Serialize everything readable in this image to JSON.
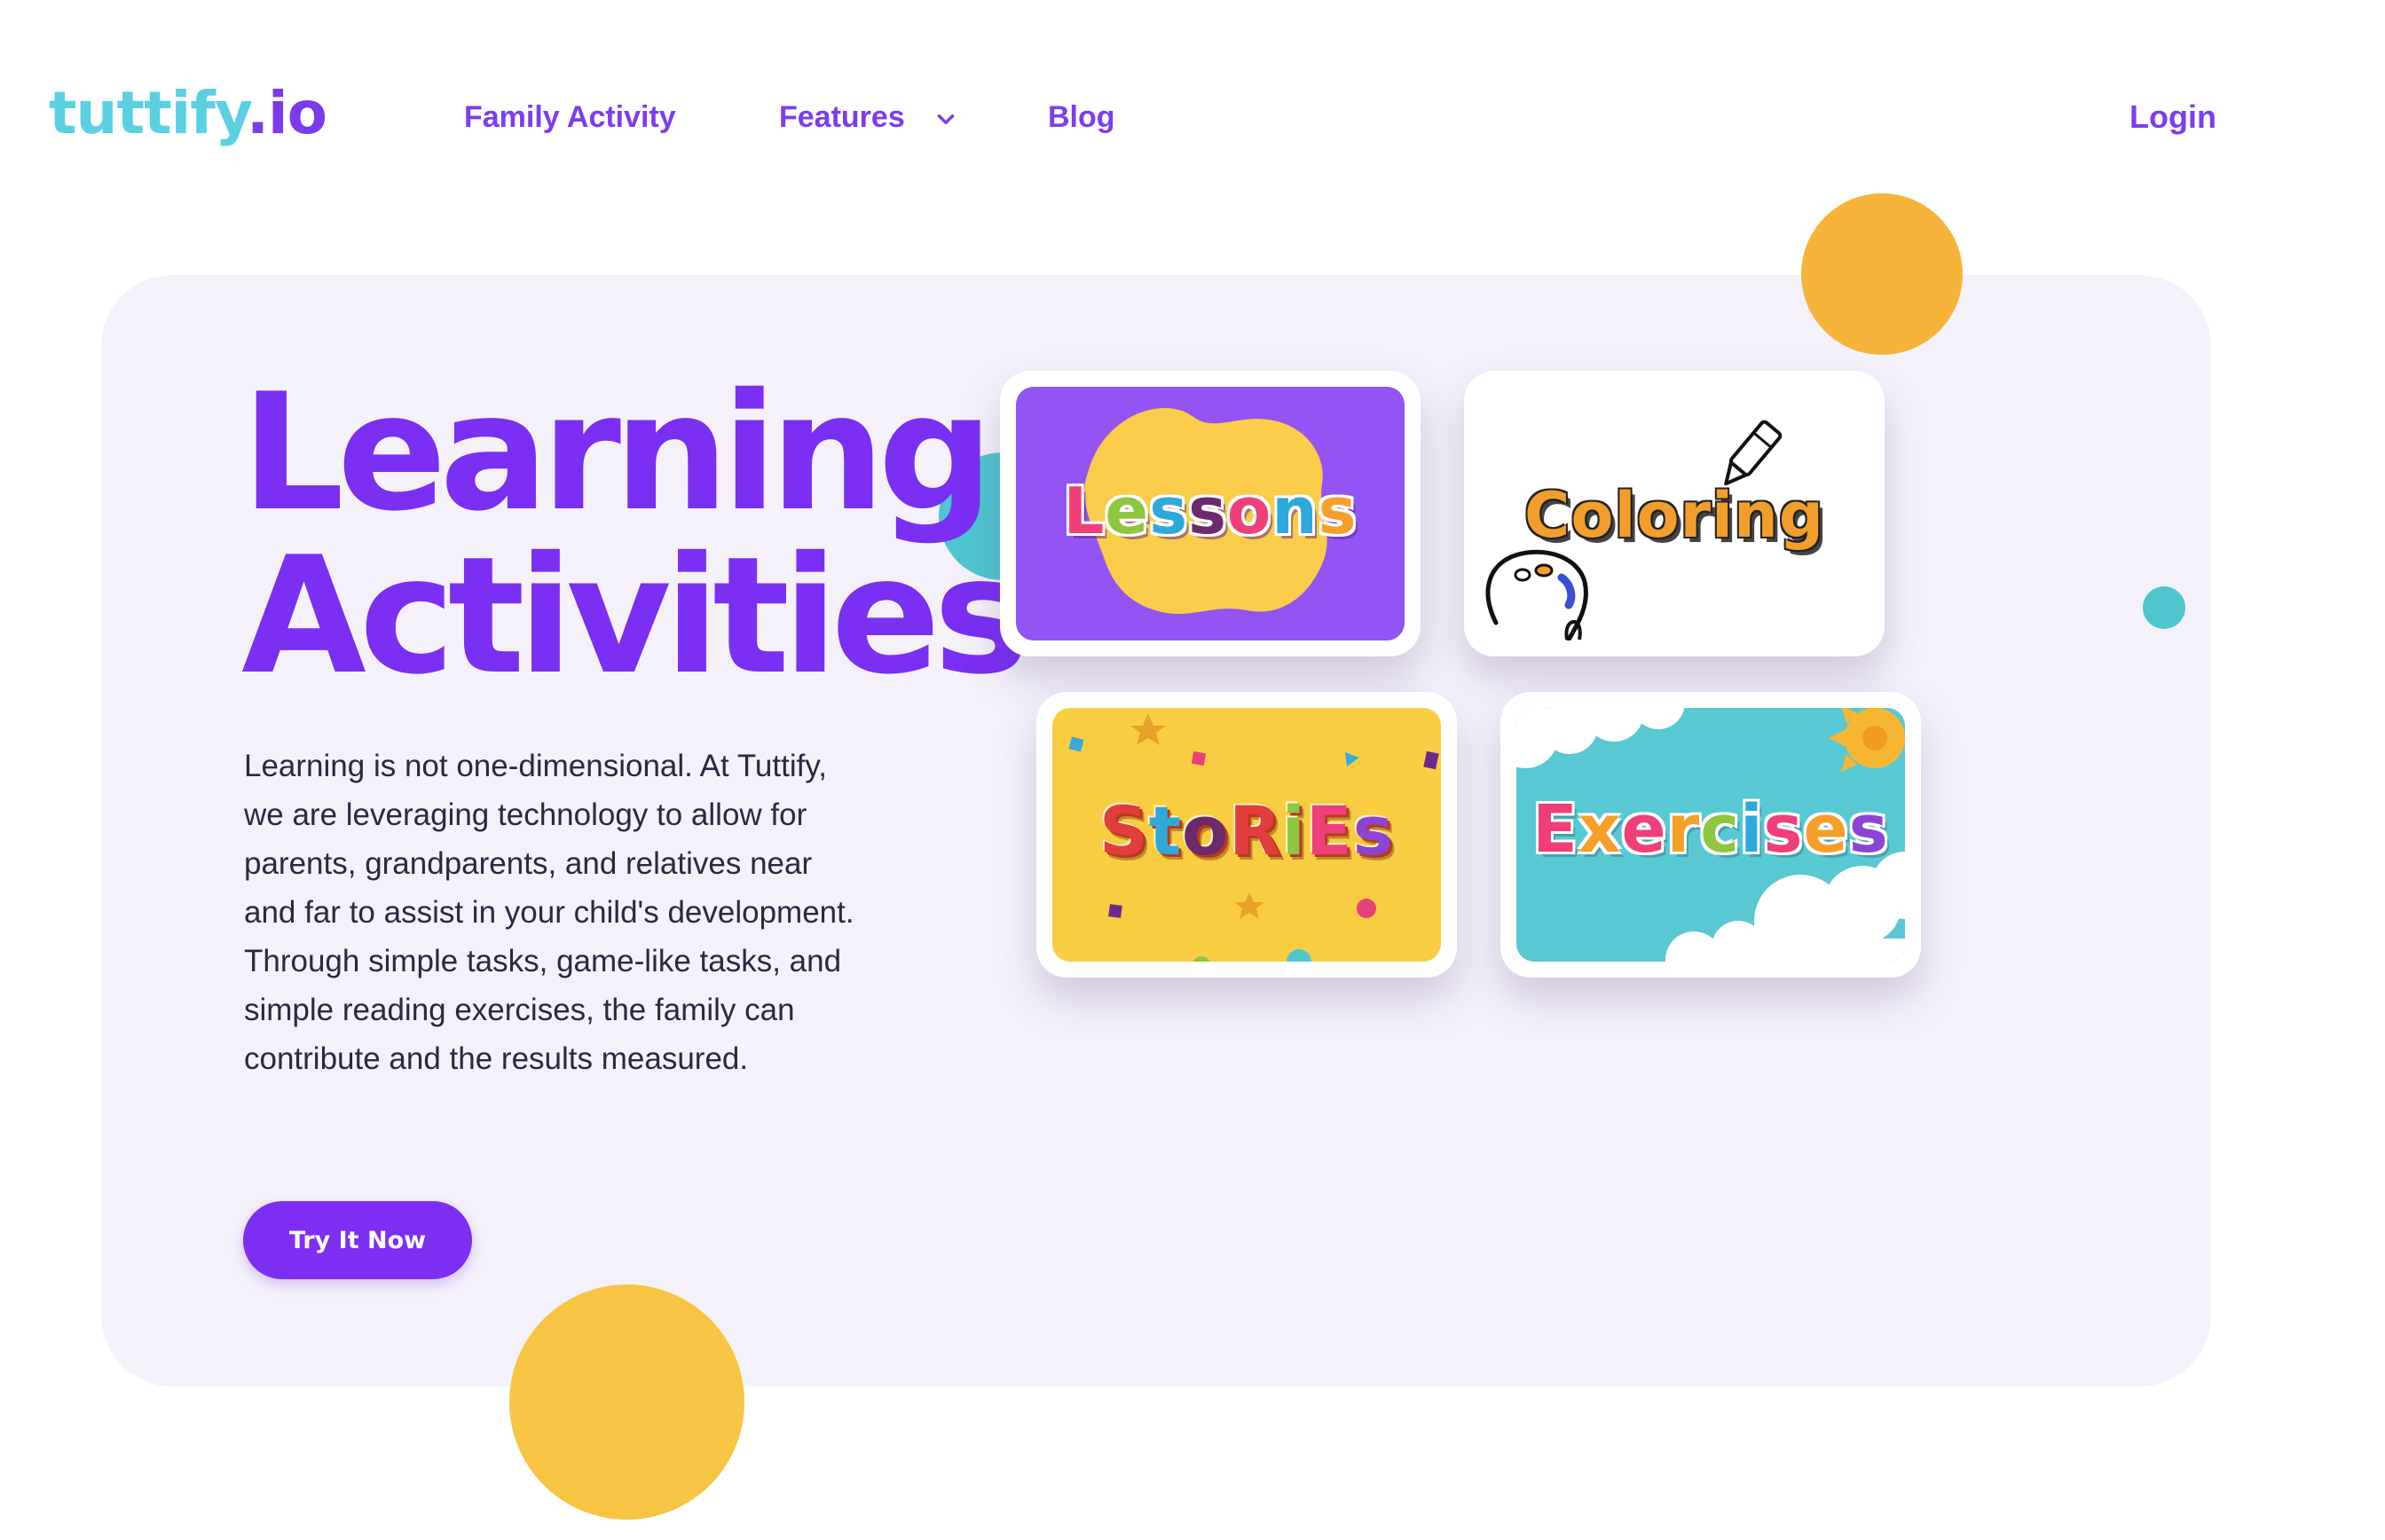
{
  "brand": {
    "logo_part1": "tuttify",
    "logo_part2": ".io",
    "colors": {
      "primary": "#7b2ff2",
      "logo_cyan": "#5bd0e3",
      "hero_bg": "#f4f1fb",
      "accent_yellow": "#f7c543",
      "accent_orange": "#f6b53a",
      "accent_teal": "#4fc6cf"
    }
  },
  "nav": {
    "family_activity": "Family Activity",
    "features": "Features",
    "features_icon": "chevron-down-icon",
    "blog": "Blog",
    "login": "Login"
  },
  "hero": {
    "title_line1": "Learning",
    "title_line2": "Activities",
    "description": "Learning is not one-dimensional. At Tuttify, we are leveraging technology to allow for parents, grandparents, and relatives near and far to assist in your child's development. Through simple tasks, game-like tasks, and simple reading exercises, the family can contribute and the results measured.",
    "cta_label": "Try It Now"
  },
  "tiles": [
    {
      "label": "Lessons"
    },
    {
      "label": "Coloring"
    },
    {
      "label": "Stories"
    },
    {
      "label": "Exercises"
    }
  ]
}
